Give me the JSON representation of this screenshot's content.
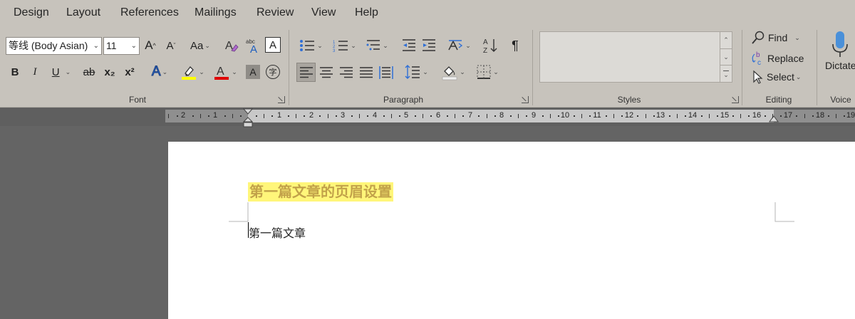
{
  "menu": {
    "tabs": [
      "Design",
      "Layout",
      "References",
      "Mailings",
      "Review",
      "View",
      "Help"
    ]
  },
  "font_group": {
    "label": "Font",
    "font_name": "等线 (Body Asian)",
    "font_size": "11",
    "grow_font_label": "A",
    "shrink_font_label": "A",
    "change_case_label": "Aa",
    "bold_label": "B",
    "italic_label": "I",
    "underline_label": "U",
    "strikethrough_label": "ab",
    "subscript_label": "x₂",
    "superscript_label": "x²",
    "text_effects_label": "A",
    "font_color_label": "A",
    "char_shading_label": "A",
    "enclose_char_label": "字",
    "highlight_color": "#ffff00",
    "font_color": "#e00000"
  },
  "paragraph_group": {
    "label": "Paragraph",
    "sort_label": "A Z",
    "show_marks_label": "¶"
  },
  "styles_group": {
    "label": "Styles"
  },
  "editing_group": {
    "label": "Editing",
    "find_label": "Find",
    "replace_label": "Replace",
    "select_label": "Select"
  },
  "voice_group": {
    "label": "Voice",
    "dictate_label": "Dictate"
  },
  "ruler": {
    "left_labels": [
      "2",
      "1"
    ],
    "right_labels": [
      "1",
      "2",
      "3",
      "4",
      "5",
      "6",
      "7",
      "8",
      "9",
      "10",
      "11",
      "12",
      "13",
      "14",
      "15",
      "16",
      "17",
      "18",
      "19"
    ]
  },
  "document": {
    "heading": "第一篇文章的页眉设置",
    "body_text": "第一篇文章"
  },
  "colors": {
    "ribbon_bg": "#c7c3bc",
    "workspace_bg": "#646464",
    "heading_highlight": "#fff67a",
    "heading_text": "#c2a24a",
    "align_pressed": "#a9a59f"
  }
}
